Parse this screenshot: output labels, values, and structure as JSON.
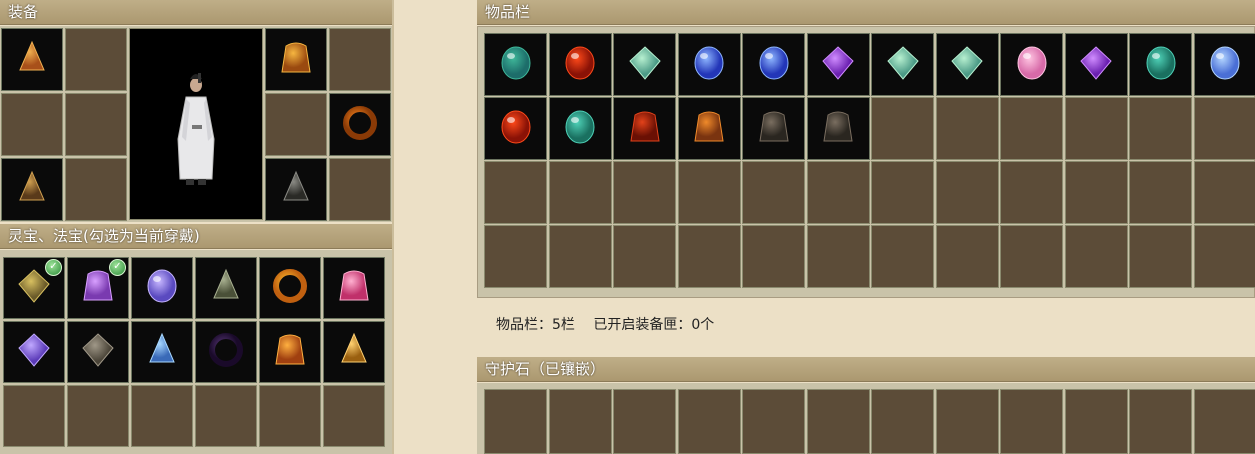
{
  "equipment": {
    "title": "装备",
    "slots": [
      {
        "icon": "mountain-amulet-icon"
      },
      {
        "icon": "empty"
      },
      {
        "icon": "golden-helmet-icon"
      },
      {
        "icon": "empty"
      },
      {
        "icon": "empty"
      },
      {
        "icon": "empty"
      },
      {
        "icon": "empty"
      },
      {
        "icon": "fire-ring-icon"
      },
      {
        "icon": "tassel-necklace-icon"
      },
      {
        "icon": "empty"
      },
      {
        "icon": "dark-belt-icon"
      },
      {
        "icon": "empty"
      }
    ]
  },
  "treasures": {
    "title": "灵宝、法宝(勾选为当前穿戴)",
    "items": [
      {
        "icon": "jade-tablet-icon",
        "checked": true
      },
      {
        "icon": "purple-lantern-icon",
        "checked": true
      },
      {
        "icon": "lightning-orb-icon",
        "checked": false
      },
      {
        "icon": "stone-bell-icon",
        "checked": false
      },
      {
        "icon": "golden-cloud-icon",
        "checked": false
      },
      {
        "icon": "pink-lantern-icon",
        "checked": false
      },
      {
        "icon": "violet-scroll-icon",
        "checked": false
      },
      {
        "icon": "stone-tablet-icon",
        "checked": false
      },
      {
        "icon": "ice-fan-icon",
        "checked": false
      },
      {
        "icon": "dark-vortex-icon",
        "checked": false
      },
      {
        "icon": "fire-pagoda-icon",
        "checked": false
      },
      {
        "icon": "golden-staff-icon",
        "checked": false
      }
    ]
  },
  "inventory": {
    "title": "物品栏",
    "items": [
      "teal-gem-icon",
      "red-oval-gem-icon",
      "jade-slip-icon",
      "blue-crystal-icon",
      "blue-crystal-icon",
      "purple-diamond-icon",
      "jade-slip-icon",
      "jade-slip-icon",
      "pink-heart-gem-icon",
      "purple-diamond-icon",
      "teal-drop-gem-icon",
      "blue-prism-icon",
      "red-oval-gem-icon",
      "teal-drop-gem-icon",
      "red-robe-icon",
      "fire-helmet-icon",
      "dark-armor-icon",
      "dark-armor-icon"
    ]
  },
  "status": {
    "capacity": "物品栏：5栏",
    "chests": "已开启装备匣：0个"
  },
  "guard_stones": {
    "title": "守护石（已镶嵌）"
  },
  "colors": {
    "header_bg": "#b7a47d",
    "cell_empty": "#5c4c38",
    "page_bg": "#ece0c6"
  }
}
